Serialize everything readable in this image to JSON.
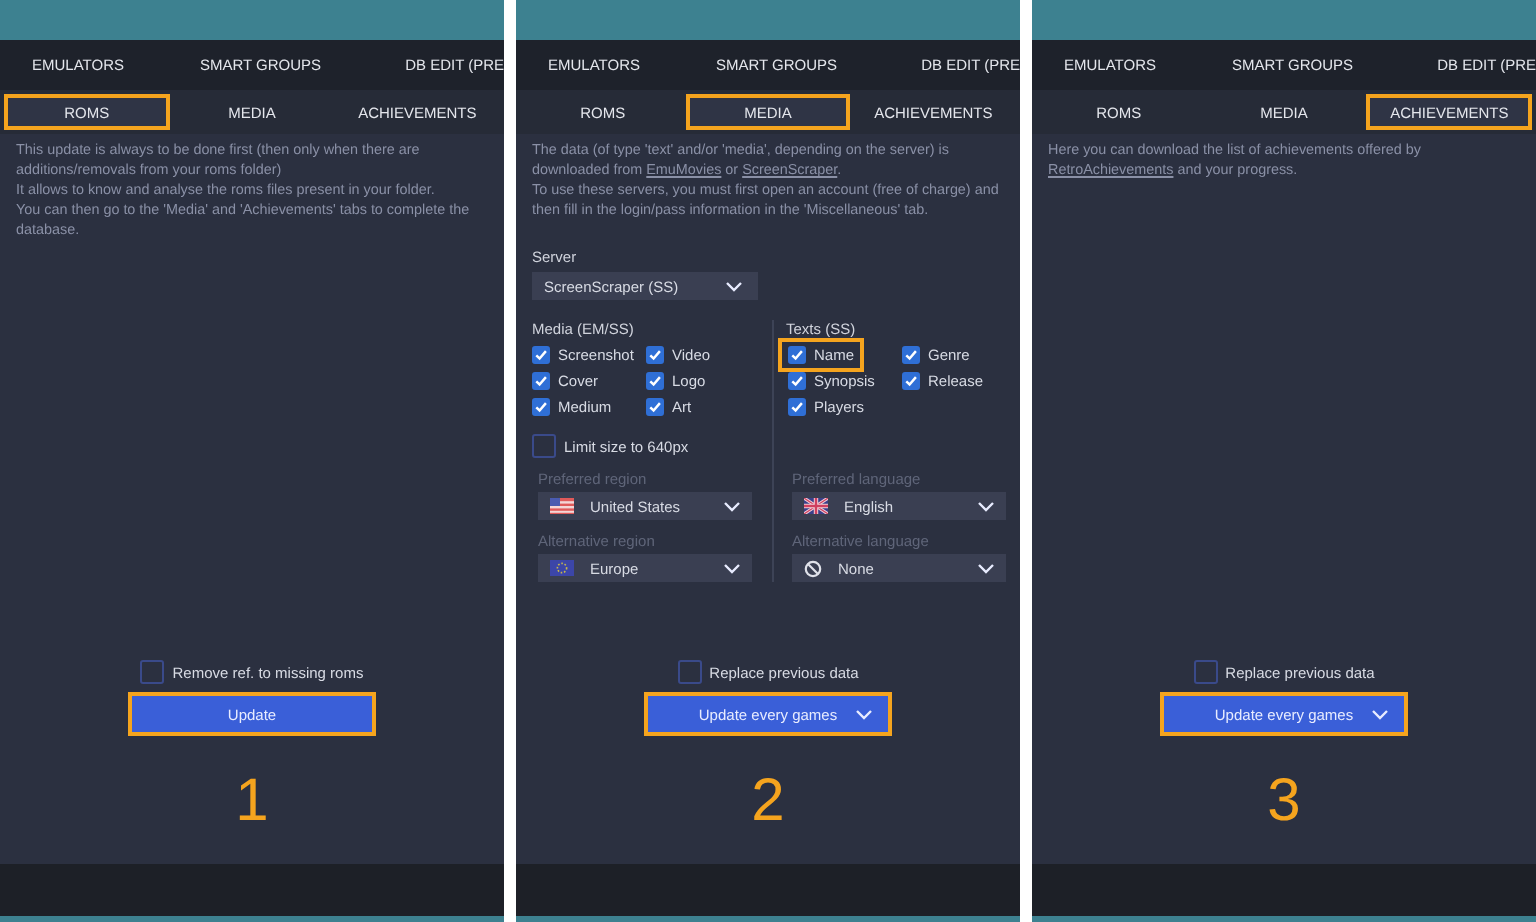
{
  "panels": [
    {
      "top_tabs": [
        "EMULATORS",
        "SMART GROUPS",
        "DB EDIT (PRE"
      ],
      "sub_tabs": [
        {
          "label": "ROMS",
          "selected": true
        },
        {
          "label": "MEDIA",
          "selected": false
        },
        {
          "label": "ACHIEVEMENTS",
          "selected": false
        }
      ],
      "description": [
        [
          {
            "text": "This update is always to be done first (then only when there are additions/removals from your roms folder)"
          }
        ],
        [
          {
            "text": "It allows to know and analyse the roms files present in your folder."
          }
        ],
        [
          {
            "text": "You can then go to the 'Media' and 'Achievements' tabs to complete the database."
          }
        ]
      ],
      "footer_checkbox": {
        "label": "Remove ref. to missing roms",
        "checked": false
      },
      "action": {
        "label": "Update",
        "kind": "button",
        "highlighted": true
      },
      "step": "1"
    },
    {
      "top_tabs": [
        "EMULATORS",
        "SMART GROUPS",
        "DB EDIT (PRE"
      ],
      "sub_tabs": [
        {
          "label": "ROMS",
          "selected": false
        },
        {
          "label": "MEDIA",
          "selected": true
        },
        {
          "label": "ACHIEVEMENTS",
          "selected": false
        }
      ],
      "description": [
        [
          {
            "text": "The data (of type 'text' and/or 'media', depending on the server) is downloaded from "
          },
          {
            "text": "EmuMovies",
            "link": true
          },
          {
            "text": " or "
          },
          {
            "text": "ScreenScraper",
            "link": true
          },
          {
            "text": "."
          }
        ],
        [
          {
            "text": "To use these servers, you must first open an account (free of charge) and then fill in the login/pass information in the 'Miscellaneous' tab."
          }
        ]
      ],
      "settings": {
        "server": {
          "label": "Server",
          "value": "ScreenScraper (SS)"
        },
        "media": {
          "title": "Media (EM/SS)",
          "options": [
            {
              "label": "Screenshot",
              "checked": true
            },
            {
              "label": "Video",
              "checked": true
            },
            {
              "label": "Cover",
              "checked": true
            },
            {
              "label": "Logo",
              "checked": true
            },
            {
              "label": "Medium",
              "checked": true
            },
            {
              "label": "Art",
              "checked": true
            }
          ],
          "limit": {
            "label": "Limit size to 640px",
            "checked": false
          },
          "selects": [
            {
              "label": "Preferred region",
              "value": "United States"
            },
            {
              "label": "Alternative region",
              "value": "Europe"
            }
          ]
        },
        "texts": {
          "title": "Texts (SS)",
          "options": [
            {
              "label": "Name",
              "checked": true,
              "highlighted": true
            },
            {
              "label": "Genre",
              "checked": true,
              "highlighted": false
            },
            {
              "label": "Synopsis",
              "checked": true,
              "highlighted": false
            },
            {
              "label": "Release",
              "checked": true,
              "highlighted": false
            },
            {
              "label": "Players",
              "checked": true,
              "highlighted": false
            }
          ],
          "selects": [
            {
              "label": "Preferred language",
              "value": "English"
            },
            {
              "label": "Alternative language",
              "value": "None"
            }
          ]
        }
      },
      "footer_checkbox": {
        "label": "Replace previous data",
        "checked": false
      },
      "action": {
        "label": "Update every games",
        "kind": "dropdown",
        "highlighted": true
      },
      "step": "2"
    },
    {
      "top_tabs": [
        "EMULATORS",
        "SMART GROUPS",
        "DB EDIT (PRE"
      ],
      "sub_tabs": [
        {
          "label": "ROMS",
          "selected": false
        },
        {
          "label": "MEDIA",
          "selected": false
        },
        {
          "label": "ACHIEVEMENTS",
          "selected": true
        }
      ],
      "description": [
        [
          {
            "text": "Here you can download the list of achievements offered by "
          },
          {
            "text": "RetroAchievements",
            "link": true
          },
          {
            "text": " and your progress."
          }
        ]
      ],
      "footer_checkbox": {
        "label": "Replace previous data",
        "checked": false
      },
      "action": {
        "label": "Update every games",
        "kind": "dropdown",
        "highlighted": true
      },
      "step": "3"
    }
  ]
}
